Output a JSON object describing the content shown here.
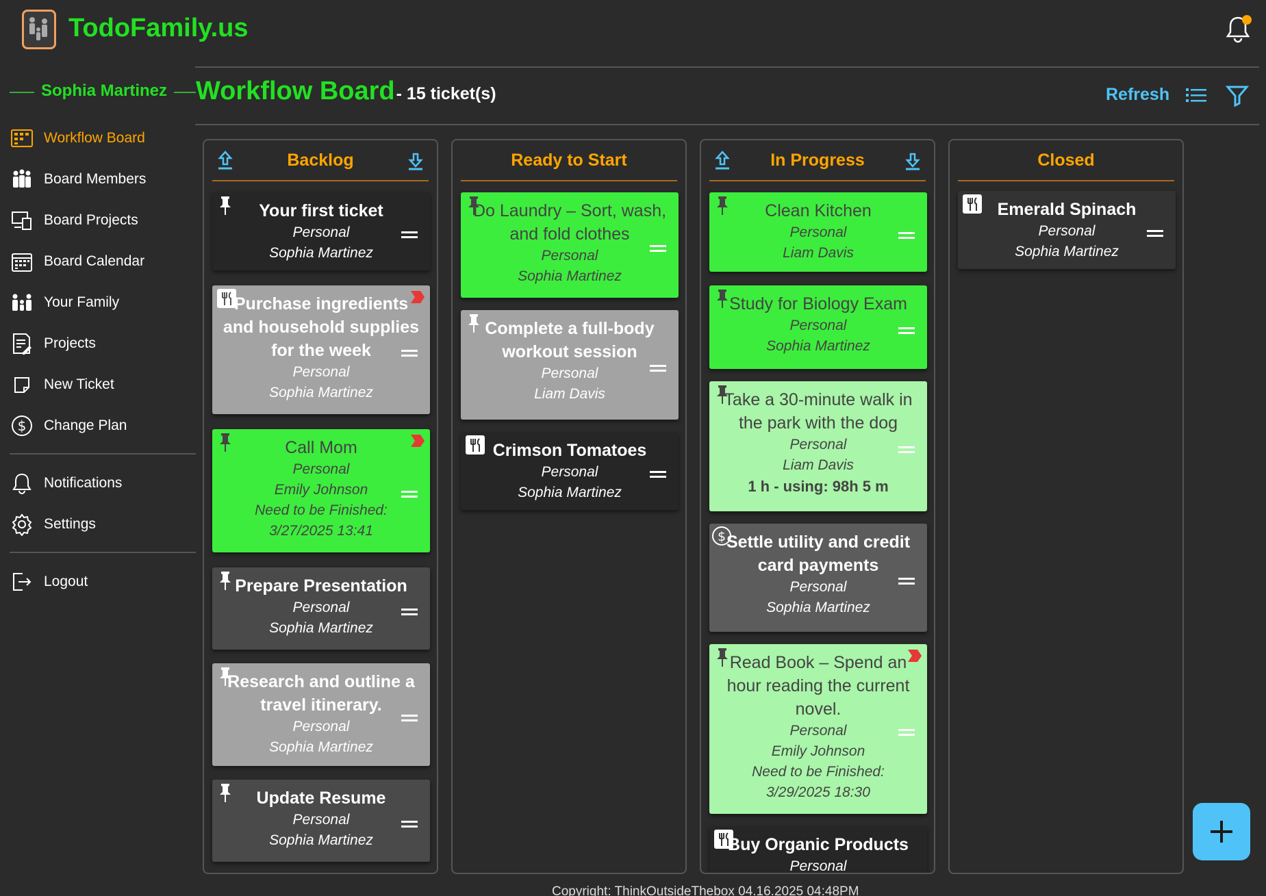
{
  "app": {
    "brand": "TodoFamily.us"
  },
  "user": {
    "name": "Sophia Martinez"
  },
  "sidebar": {
    "items": [
      {
        "label": "Workflow Board"
      },
      {
        "label": "Board Members"
      },
      {
        "label": "Board Projects"
      },
      {
        "label": "Board Calendar"
      },
      {
        "label": "Your Family"
      },
      {
        "label": "Projects"
      },
      {
        "label": "New Ticket"
      },
      {
        "label": "Change Plan"
      },
      {
        "label": "Notifications"
      },
      {
        "label": "Settings"
      },
      {
        "label": "Logout"
      }
    ]
  },
  "header": {
    "title": "Workflow Board",
    "count": "- 15 ticket(s)",
    "refresh": "Refresh"
  },
  "columns": [
    {
      "title": "Backlog",
      "cards": [
        {
          "title": "Your first ticket",
          "category": "Personal",
          "assignee": "Sophia Martinez"
        },
        {
          "title": "Purchase ingredients and household supplies for the week",
          "category": "Personal",
          "assignee": "Sophia Martinez"
        },
        {
          "title": "Call Mom",
          "category": "Personal",
          "assignee": "Emily Johnson",
          "due_label": "Need to be Finished:",
          "due": "3/27/2025 13:41"
        },
        {
          "title": "Prepare Presentation",
          "category": "Personal",
          "assignee": "Sophia Martinez"
        },
        {
          "title": "Research and outline a travel itinerary.",
          "category": "Personal",
          "assignee": "Sophia Martinez"
        },
        {
          "title": "Update Resume",
          "category": "Personal",
          "assignee": "Sophia Martinez"
        }
      ]
    },
    {
      "title": "Ready to Start",
      "cards": [
        {
          "title": "Do Laundry – Sort, wash, and fold clothes",
          "category": "Personal",
          "assignee": "Sophia Martinez"
        },
        {
          "title": "Complete a full-body workout session",
          "category": "Personal",
          "assignee": "Liam Davis"
        },
        {
          "title": "Crimson Tomatoes",
          "category": "Personal",
          "assignee": "Sophia Martinez"
        }
      ]
    },
    {
      "title": "In Progress",
      "cards": [
        {
          "title": "Clean Kitchen",
          "category": "Personal",
          "assignee": "Liam Davis"
        },
        {
          "title": "Study for Biology Exam",
          "category": "Personal",
          "assignee": "Sophia Martinez"
        },
        {
          "title": "Take a 30-minute walk in the park with the dog",
          "category": "Personal",
          "assignee": "Liam Davis",
          "time": "1 h - using: 98h 5 m"
        },
        {
          "title": "Settle utility and credit card payments",
          "category": "Personal",
          "assignee": "Sophia Martinez"
        },
        {
          "title": "Read Book – Spend an hour reading the current novel.",
          "category": "Personal",
          "assignee": "Emily Johnson",
          "due_label": "Need to be Finished:",
          "due": "3/29/2025 18:30"
        },
        {
          "title": "Buy Organic Products",
          "category": "Personal",
          "assignee": ""
        }
      ]
    },
    {
      "title": "Closed",
      "cards": [
        {
          "title": "Emerald Spinach",
          "category": "Personal",
          "assignee": "Sophia Martinez"
        }
      ]
    }
  ],
  "footer": {
    "text": "Copyright: ThinkOutsideThebox 04.16.2025 04:48PM"
  },
  "colors": {
    "brand_green": "#22e022",
    "accent_orange": "#ffa500",
    "link_blue": "#4fc3f7",
    "flag_red": "#e53935"
  },
  "icons": [
    "family-logo-icon",
    "bell-icon",
    "board-icon",
    "members-icon",
    "projects-icon",
    "calendar-icon",
    "family-icon",
    "projects-list-icon",
    "new-ticket-icon",
    "dollar-icon",
    "settings-icon",
    "logout-icon",
    "list-view-icon",
    "filter-icon",
    "pin-icon",
    "fork-knife-icon",
    "flag-icon",
    "drag-handle-icon",
    "arrow-up-icon",
    "arrow-down-icon",
    "plus-icon"
  ]
}
